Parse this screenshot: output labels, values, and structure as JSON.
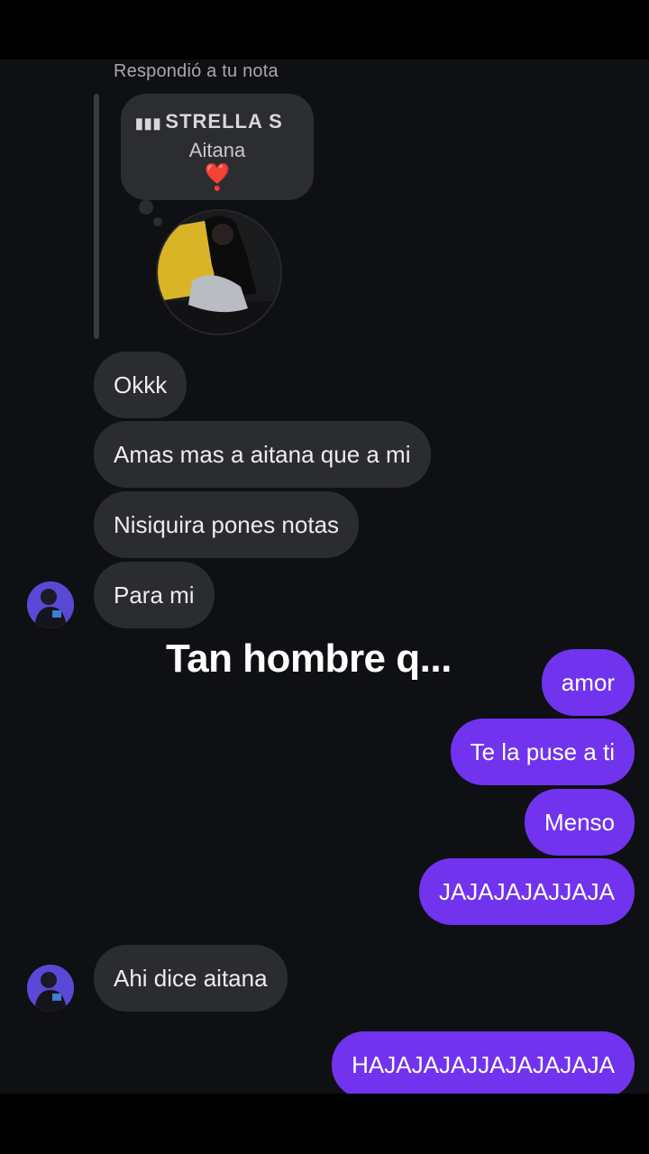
{
  "reply": {
    "label": "Respondió a tu nota",
    "note_song_bars_icon": "audio-bars-icon",
    "note_song": "STRELLA  S",
    "note_artist": "Aitana",
    "note_heart": "❣️"
  },
  "messages": [
    {
      "id": "m1",
      "direction": "in",
      "text": "Okkk"
    },
    {
      "id": "m2",
      "direction": "in",
      "text": "Amas mas a aitana que a mi"
    },
    {
      "id": "m3",
      "direction": "in",
      "text": "Nisiquira pones notas"
    },
    {
      "id": "m4",
      "direction": "in",
      "text": "Para mi"
    },
    {
      "id": "m5",
      "direction": "out",
      "text": "amor"
    },
    {
      "id": "m6",
      "direction": "out",
      "text": "Te la puse a ti"
    },
    {
      "id": "m7",
      "direction": "out",
      "text": "Menso"
    },
    {
      "id": "m8",
      "direction": "out",
      "text": "JAJAJAJAJJAJA"
    },
    {
      "id": "m9",
      "direction": "in",
      "text": "Ahi dice aitana"
    },
    {
      "id": "m10",
      "direction": "out",
      "text": "HAJAJAJAJJAJAJAJAJA"
    }
  ],
  "overlay_caption": "Tan hombre q...",
  "colors": {
    "background": "#0e1013",
    "incoming_bubble": "#2b2c30",
    "outgoing_bubble": "#7133ee"
  }
}
